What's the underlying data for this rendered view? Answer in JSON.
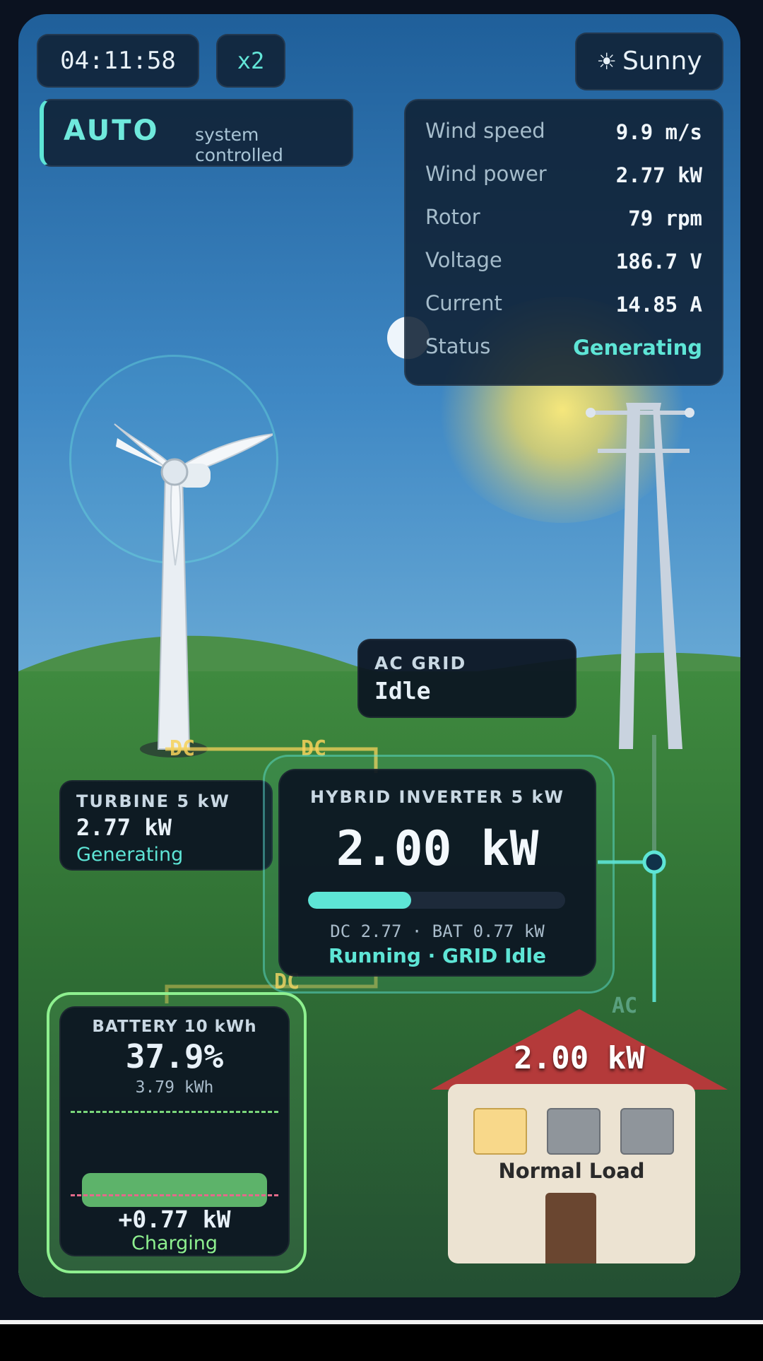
{
  "header": {
    "clock": "04:11:58",
    "speed": "x2",
    "weather_icon": "sun-icon",
    "weather": "Sunny"
  },
  "mode": {
    "label": "AUTO",
    "sub": "system controlled"
  },
  "stats": [
    {
      "key": "Wind speed",
      "value": "9.9 m/s"
    },
    {
      "key": "Wind power",
      "value": "2.77 kW"
    },
    {
      "key": "Rotor",
      "value": "79 rpm"
    },
    {
      "key": "Voltage",
      "value": "186.7 V"
    },
    {
      "key": "Current",
      "value": "14.85 A"
    },
    {
      "key": "Status",
      "value": "Generating"
    }
  ],
  "ac_grid": {
    "title": "AC GRID",
    "state": "Idle"
  },
  "turbine": {
    "title": "TURBINE 5 kW",
    "power": "2.77 kW",
    "status": "Generating"
  },
  "inverter": {
    "title": "HYBRID INVERTER 5 kW",
    "power": "2.00 kW",
    "load_fraction": 0.4,
    "detail": "DC 2.77 · BAT 0.77 kW",
    "status": "Running · GRID Idle"
  },
  "battery": {
    "title": "BATTERY 10 kWh",
    "percent": "37.9%",
    "energy": "3.79 kWh",
    "power": "+0.77 kW",
    "status": "Charging"
  },
  "house": {
    "power": "2.00 kW",
    "label": "Normal Load"
  },
  "flow_tags": {
    "dc1": "DC",
    "dc2": "DC",
    "dc3": "DC",
    "ac": "AC"
  },
  "colors": {
    "accent": "#5ee5d6",
    "dc_line": "#f7d25a",
    "battery": "#8ef08f"
  }
}
